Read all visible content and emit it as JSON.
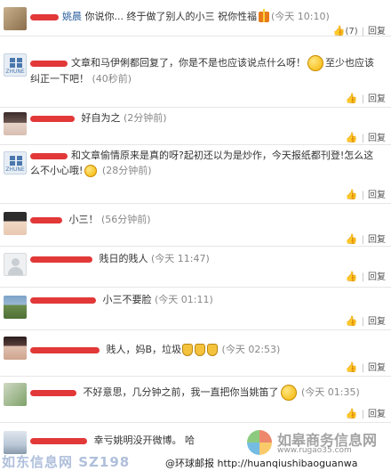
{
  "comments": [
    {
      "name": "姚晨",
      "text": "你说你... 终于做了别人的小三 祝你性福",
      "time": "(今天 10:10)",
      "like_count": "(7)",
      "reply": "回复"
    },
    {
      "text": "文章和马伊俐都回复了，你是不是也应该说点什么呀！",
      "text2": "至少也应该纠正一下吧！",
      "time": "(40秒前)",
      "reply": "回复",
      "avatar_text": "ZHUNE"
    },
    {
      "text": "好自为之",
      "time": "(2分钟前)",
      "reply": "回复"
    },
    {
      "text": "和文章偷情原来是真的呀?起初还以为是炒作，今天报纸都刊登!怎么这么不小心",
      "text2": "哦!",
      "time": "(28分钟前)",
      "reply": "回复",
      "avatar_text": "ZHUNE"
    },
    {
      "text": "小三！",
      "time": "(56分钟前)",
      "reply": "回复"
    },
    {
      "text": "贱日的贱人",
      "time": "(今天 11:47)",
      "reply": "回复"
    },
    {
      "text": "小三不要脸",
      "time": "(今天 01:11)",
      "reply": "回复"
    },
    {
      "text": "贱人，妈B，垃圾",
      "time": "(今天 02:53)",
      "reply": "回复"
    },
    {
      "text": "不好意思，几分钟之前，我一直把你当姚笛了",
      "time": "(今天 01:35)",
      "reply": "回复"
    },
    {
      "text": "幸亏姚明没开微博。",
      "text_tail": "哈"
    }
  ],
  "watermarks": {
    "left": "如东信息网 SZ198",
    "site_name": "如皋商务信息网",
    "site_url": "www.rugao35.com",
    "bottom": "@环球邮报 http://huanqiushibaoguanwa"
  },
  "colors": {
    "accent": "#2a5e9e",
    "redaction": "#e23838"
  }
}
